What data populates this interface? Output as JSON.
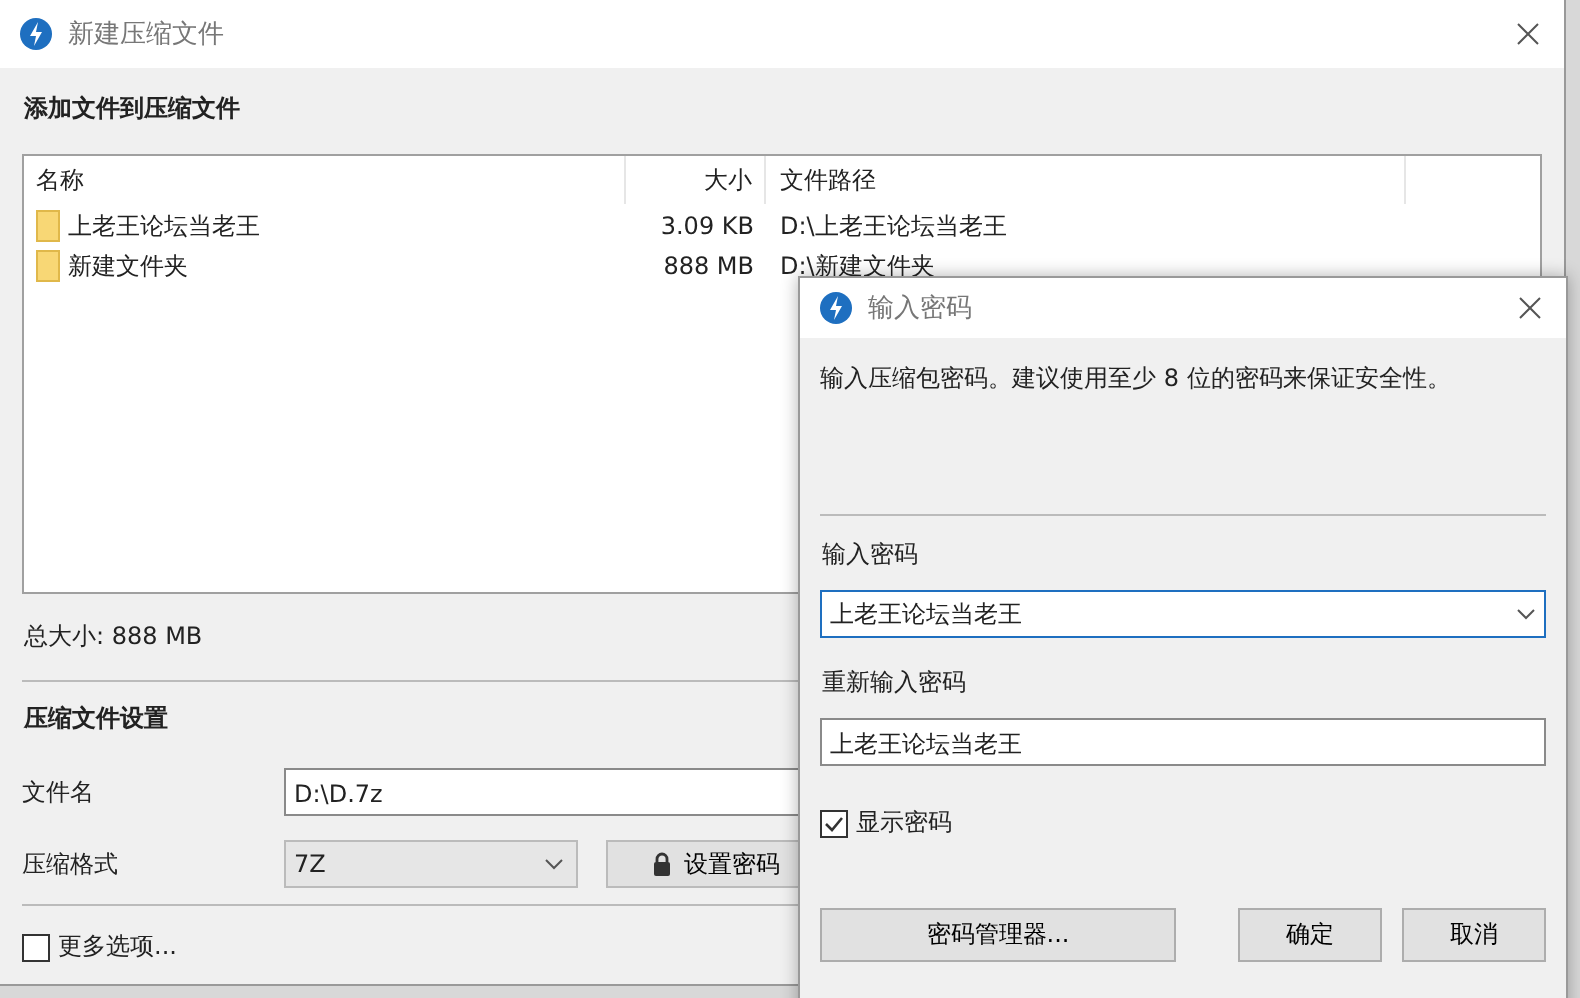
{
  "main_window": {
    "title": "新建压缩文件",
    "section_title": "添加文件到压缩文件",
    "file_list": {
      "columns": [
        "名称",
        "大小",
        "文件路径"
      ],
      "rows": [
        {
          "name": "上老王论坛当老王",
          "size": "3.09 KB",
          "path": "D:\\上老王论坛当老王"
        },
        {
          "name": "新建文件夹",
          "size": "888 MB",
          "path": "D:\\新建文件夹"
        }
      ]
    },
    "total_size": "总大小: 888 MB",
    "settings_title": "压缩文件设置",
    "filename": {
      "label": "文件名",
      "value": "D:\\D.7z"
    },
    "format": {
      "label": "压缩格式",
      "value": "7Z"
    },
    "set_password_button": "设置密码",
    "more_options": {
      "label": "更多选项...",
      "checked": false
    }
  },
  "password_dialog": {
    "title": "输入密码",
    "description": "输入压缩包密码。建议使用至少 8 位的密码来保证安全性。",
    "password": {
      "label": "输入密码",
      "value": "上老王论坛当老王"
    },
    "confirm": {
      "label": "重新输入密码",
      "value": "上老王论坛当老王"
    },
    "show_password": {
      "label": "显示密码",
      "checked": true
    },
    "buttons": [
      "密码管理器...",
      "确定",
      "取消"
    ]
  }
}
